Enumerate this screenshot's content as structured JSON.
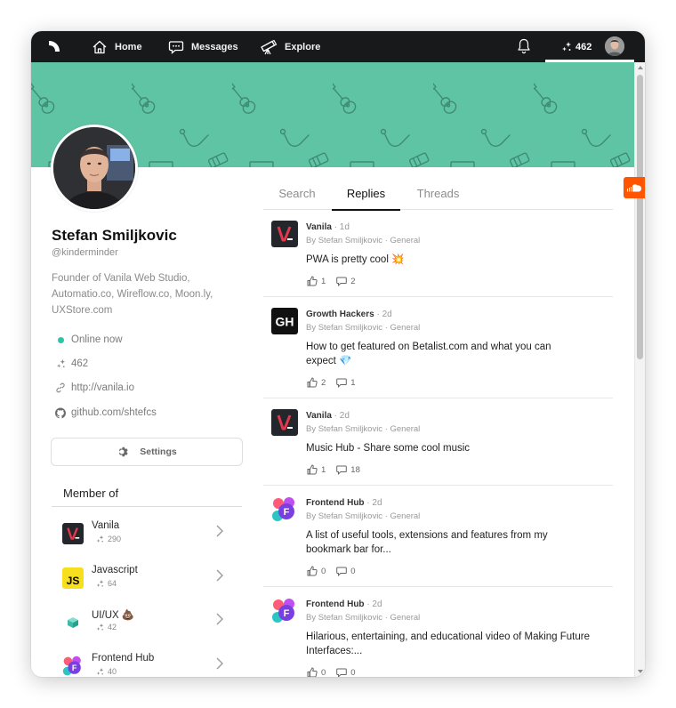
{
  "nav": {
    "home": "Home",
    "messages": "Messages",
    "explore": "Explore",
    "points": "462"
  },
  "profile": {
    "name": "Stefan Smiljkovic",
    "handle": "@kinderminder",
    "bio": "Founder of Vanila Web Studio, Automatio.co, Wireflow.co, Moon.ly, UXStore.com",
    "status": "Online now",
    "points": "462",
    "website": "http://vanila.io",
    "github": "github.com/shtefcs",
    "settings_label": "Settings",
    "member_of_title": "Member of"
  },
  "groups": [
    {
      "name": "Vanila",
      "points": "290",
      "icon": "vanila-logo"
    },
    {
      "name": "Javascript",
      "points": "64",
      "icon": "js-logo"
    },
    {
      "name": "UI/UX 💩",
      "points": "42",
      "icon": "uiux-logo"
    },
    {
      "name": "Frontend Hub",
      "points": "40",
      "icon": "frontend-hub-logo"
    }
  ],
  "tabs": [
    "Search",
    "Replies",
    "Threads"
  ],
  "active_tab": "Replies",
  "posts": [
    {
      "group": "Vanila",
      "time": " · 1d",
      "by": "By Stefan Smiljkovic · General",
      "text": "PWA is pretty cool 💥",
      "likes": "1",
      "comments": "2",
      "icon": "vanila-logo"
    },
    {
      "group": "Growth Hackers",
      "time": " · 2d",
      "by": "By Stefan Smiljkovic · General",
      "text": "How to get featured on Betalist.com and what you can expect 💎",
      "likes": "2",
      "comments": "1",
      "icon": "gh-logo"
    },
    {
      "group": "Vanila",
      "time": " · 2d",
      "by": "By Stefan Smiljkovic · General",
      "text": "Music Hub - Share some cool music",
      "likes": "1",
      "comments": "18",
      "icon": "vanila-logo"
    },
    {
      "group": "Frontend Hub",
      "time": " · 2d",
      "by": "By Stefan Smiljkovic · General",
      "text": "A list of useful tools, extensions and features from my bookmark bar for...",
      "likes": "0",
      "comments": "0",
      "icon": "frontend-hub-logo"
    },
    {
      "group": "Frontend Hub",
      "time": " · 2d",
      "by": "By Stefan Smiljkovic · General",
      "text": "Hilarious, entertaining, and educational video of Making Future Interfaces:...",
      "likes": "0",
      "comments": "0",
      "icon": "frontend-hub-logo"
    }
  ],
  "colors": {
    "nav_bg": "#18191b",
    "banner": "#5fc4a3",
    "online": "#2ec4a8",
    "soundcloud": "#ff5500"
  }
}
